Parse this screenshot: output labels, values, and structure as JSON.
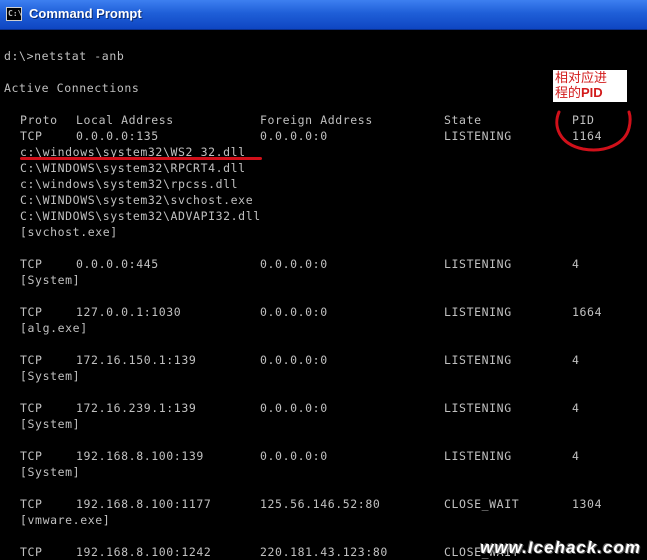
{
  "window": {
    "title": "Command Prompt",
    "icon": "cmd-icon",
    "icon_text": "C:\\"
  },
  "console": {
    "prompt": "d:\\>netstat -anb",
    "section_title": "Active Connections",
    "headers": {
      "proto": "Proto",
      "local": "Local Address",
      "foreign": "Foreign Address",
      "state": "State",
      "pid": "PID"
    },
    "rows": [
      {
        "proto": "TCP",
        "local": "0.0.0.0:135",
        "foreign": "0.0.0.0:0",
        "state": "LISTENING",
        "pid": "1164",
        "modules": [
          "c:\\windows\\system32\\WS2_32.dll",
          "C:\\WINDOWS\\system32\\RPCRT4.dll",
          "c:\\windows\\system32\\rpcss.dll",
          "C:\\WINDOWS\\system32\\svchost.exe",
          "C:\\WINDOWS\\system32\\ADVAPI32.dll",
          "[svchost.exe]"
        ]
      },
      {
        "proto": "TCP",
        "local": "0.0.0.0:445",
        "foreign": "0.0.0.0:0",
        "state": "LISTENING",
        "pid": "4",
        "modules": [
          "[System]"
        ]
      },
      {
        "proto": "TCP",
        "local": "127.0.0.1:1030",
        "foreign": "0.0.0.0:0",
        "state": "LISTENING",
        "pid": "1664",
        "modules": [
          "[alg.exe]"
        ]
      },
      {
        "proto": "TCP",
        "local": "172.16.150.1:139",
        "foreign": "0.0.0.0:0",
        "state": "LISTENING",
        "pid": "4",
        "modules": [
          "[System]"
        ]
      },
      {
        "proto": "TCP",
        "local": "172.16.239.1:139",
        "foreign": "0.0.0.0:0",
        "state": "LISTENING",
        "pid": "4",
        "modules": [
          "[System]"
        ]
      },
      {
        "proto": "TCP",
        "local": "192.168.8.100:139",
        "foreign": "0.0.0.0:0",
        "state": "LISTENING",
        "pid": "4",
        "modules": [
          "[System]"
        ]
      },
      {
        "proto": "TCP",
        "local": "192.168.8.100:1177",
        "foreign": "125.56.146.52:80",
        "state": "CLOSE_WAIT",
        "pid": "1304",
        "modules": [
          "[vmware.exe]"
        ]
      },
      {
        "proto": "TCP",
        "local": "192.168.8.100:1242",
        "foreign": "220.181.43.123:80",
        "state": "CLOSE_WAIT",
        "pid": "",
        "modules": []
      }
    ]
  },
  "annotation": {
    "line1": "相对应进",
    "line2_prefix": "程的",
    "line2_tag": "PID",
    "color": "#d21a1a"
  },
  "watermark": {
    "text": "www.Icehack.com"
  }
}
